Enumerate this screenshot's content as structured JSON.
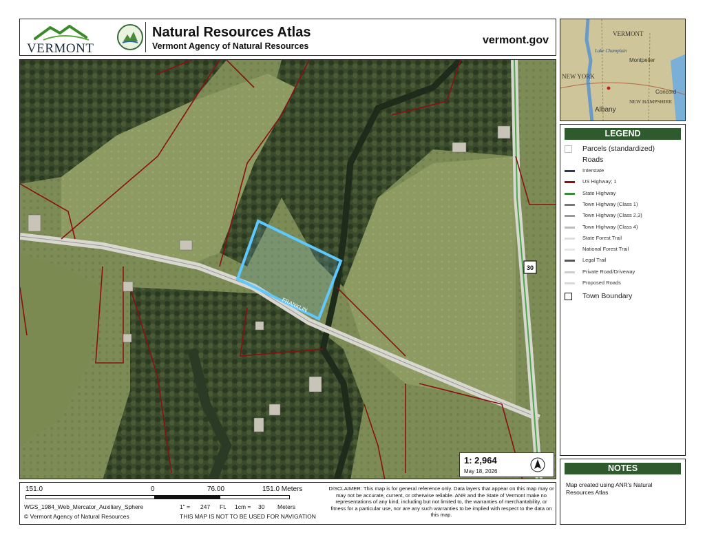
{
  "header": {
    "logo_text": "VERMONT",
    "title": "Natural Resources Atlas",
    "subtitle": "Vermont Agency of Natural Resources",
    "url": "vermont.gov"
  },
  "locator": {
    "labels": [
      "VERMONT",
      "Lake Champlain",
      "Montpelier",
      "NEW YORK",
      "Concord",
      "NEW HAMPSHIRE",
      "Albany"
    ]
  },
  "map": {
    "road_shield": "30",
    "road_label": "FRANKLIN",
    "scale_ratio": "1:  2,964",
    "date": "May 18, 2026",
    "colors": {
      "parcel_line": "#8a1010",
      "selected_parcel": "#5ec8ff",
      "field": "#8a9a5a",
      "forest": "#2b3a22"
    }
  },
  "legend": {
    "title": "LEGEND",
    "parcels": "Parcels (standardized)",
    "roads_title": "Roads",
    "items": [
      {
        "label": "Interstate",
        "color": "#2a3a5a"
      },
      {
        "label": "US Highway; 1",
        "color": "#8a1010"
      },
      {
        "label": "State Highway",
        "color": "#3b8a3b"
      },
      {
        "label": "Town Highway (Class 1)",
        "color": "#777777"
      },
      {
        "label": "Town Highway (Class 2,3)",
        "color": "#999999"
      },
      {
        "label": "Town Highway (Class 4)",
        "color": "#bbbbbb"
      },
      {
        "label": "State Forest Trail",
        "color": "#dddddd"
      },
      {
        "label": "National Forest Trail",
        "color": "#e6e6e6"
      },
      {
        "label": "Legal Trail",
        "color": "#555555"
      },
      {
        "label": "Private Road/Driveway",
        "color": "#cccccc"
      },
      {
        "label": "Proposed Roads",
        "color": "#d8d8d8"
      }
    ],
    "town_boundary": "Town Boundary"
  },
  "notes": {
    "title": "NOTES",
    "text": "Map created using ANR's Natural Resources Atlas"
  },
  "footer": {
    "scale_left": "151.0",
    "scale_zero": "0",
    "scale_mid": "76.00",
    "scale_right": "151.0 Meters",
    "projection": "WGS_1984_Web_Mercator_Auxiliary_Sphere",
    "copyright": "© Vermont Agency of Natural Resources",
    "inch": "1\" =",
    "inch_val": "247",
    "inch_unit": "Ft.",
    "cm": "1cm =",
    "cm_val": "30",
    "cm_unit": "Meters",
    "nav_warning": "THIS MAP IS NOT TO BE USED FOR NAVIGATION",
    "disclaimer": "DISCLAIMER: This map is for general reference only. Data layers that appear on this map may or may not be accurate, current, or otherwise reliable. ANR and the State of Vermont make no representations of any kind, including but not limited to, the warranties of merchantability, or fitness for a particular use, nor are any such warranties to be implied with respect to the data on this map."
  }
}
